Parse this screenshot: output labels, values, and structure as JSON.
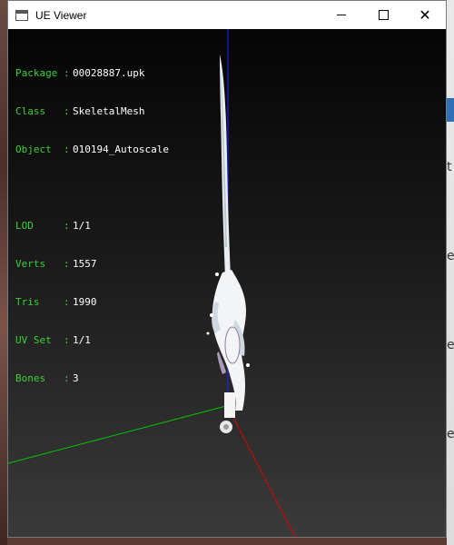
{
  "window": {
    "title": "UE Viewer",
    "controls": {
      "minimize": "minimize",
      "maximize": "maximize",
      "close": "✕"
    }
  },
  "info": {
    "package": {
      "key": "Package :",
      "value": "00028887.upk"
    },
    "class": {
      "key": "Class   :",
      "value": "SkeletalMesh"
    },
    "object": {
      "key": "Object  :",
      "value": "010194_Autoscale"
    },
    "lod": {
      "key": "LOD     :",
      "value": "1/1"
    },
    "verts": {
      "key": "Verts   :",
      "value": "1557"
    },
    "tris": {
      "key": "Tris    :",
      "value": "1990"
    },
    "uvset": {
      "key": "UV Set  :",
      "value": "1/1"
    },
    "bones": {
      "key": "Bones   :",
      "value": "3"
    }
  },
  "colors": {
    "label": "#39d039",
    "value": "#ffffff",
    "axis_x": "#ff0000",
    "axis_y": "#00c800",
    "axis_z": "#2020ff"
  },
  "desktop_edge_chars": [
    "t",
    "e",
    "e",
    "e"
  ]
}
